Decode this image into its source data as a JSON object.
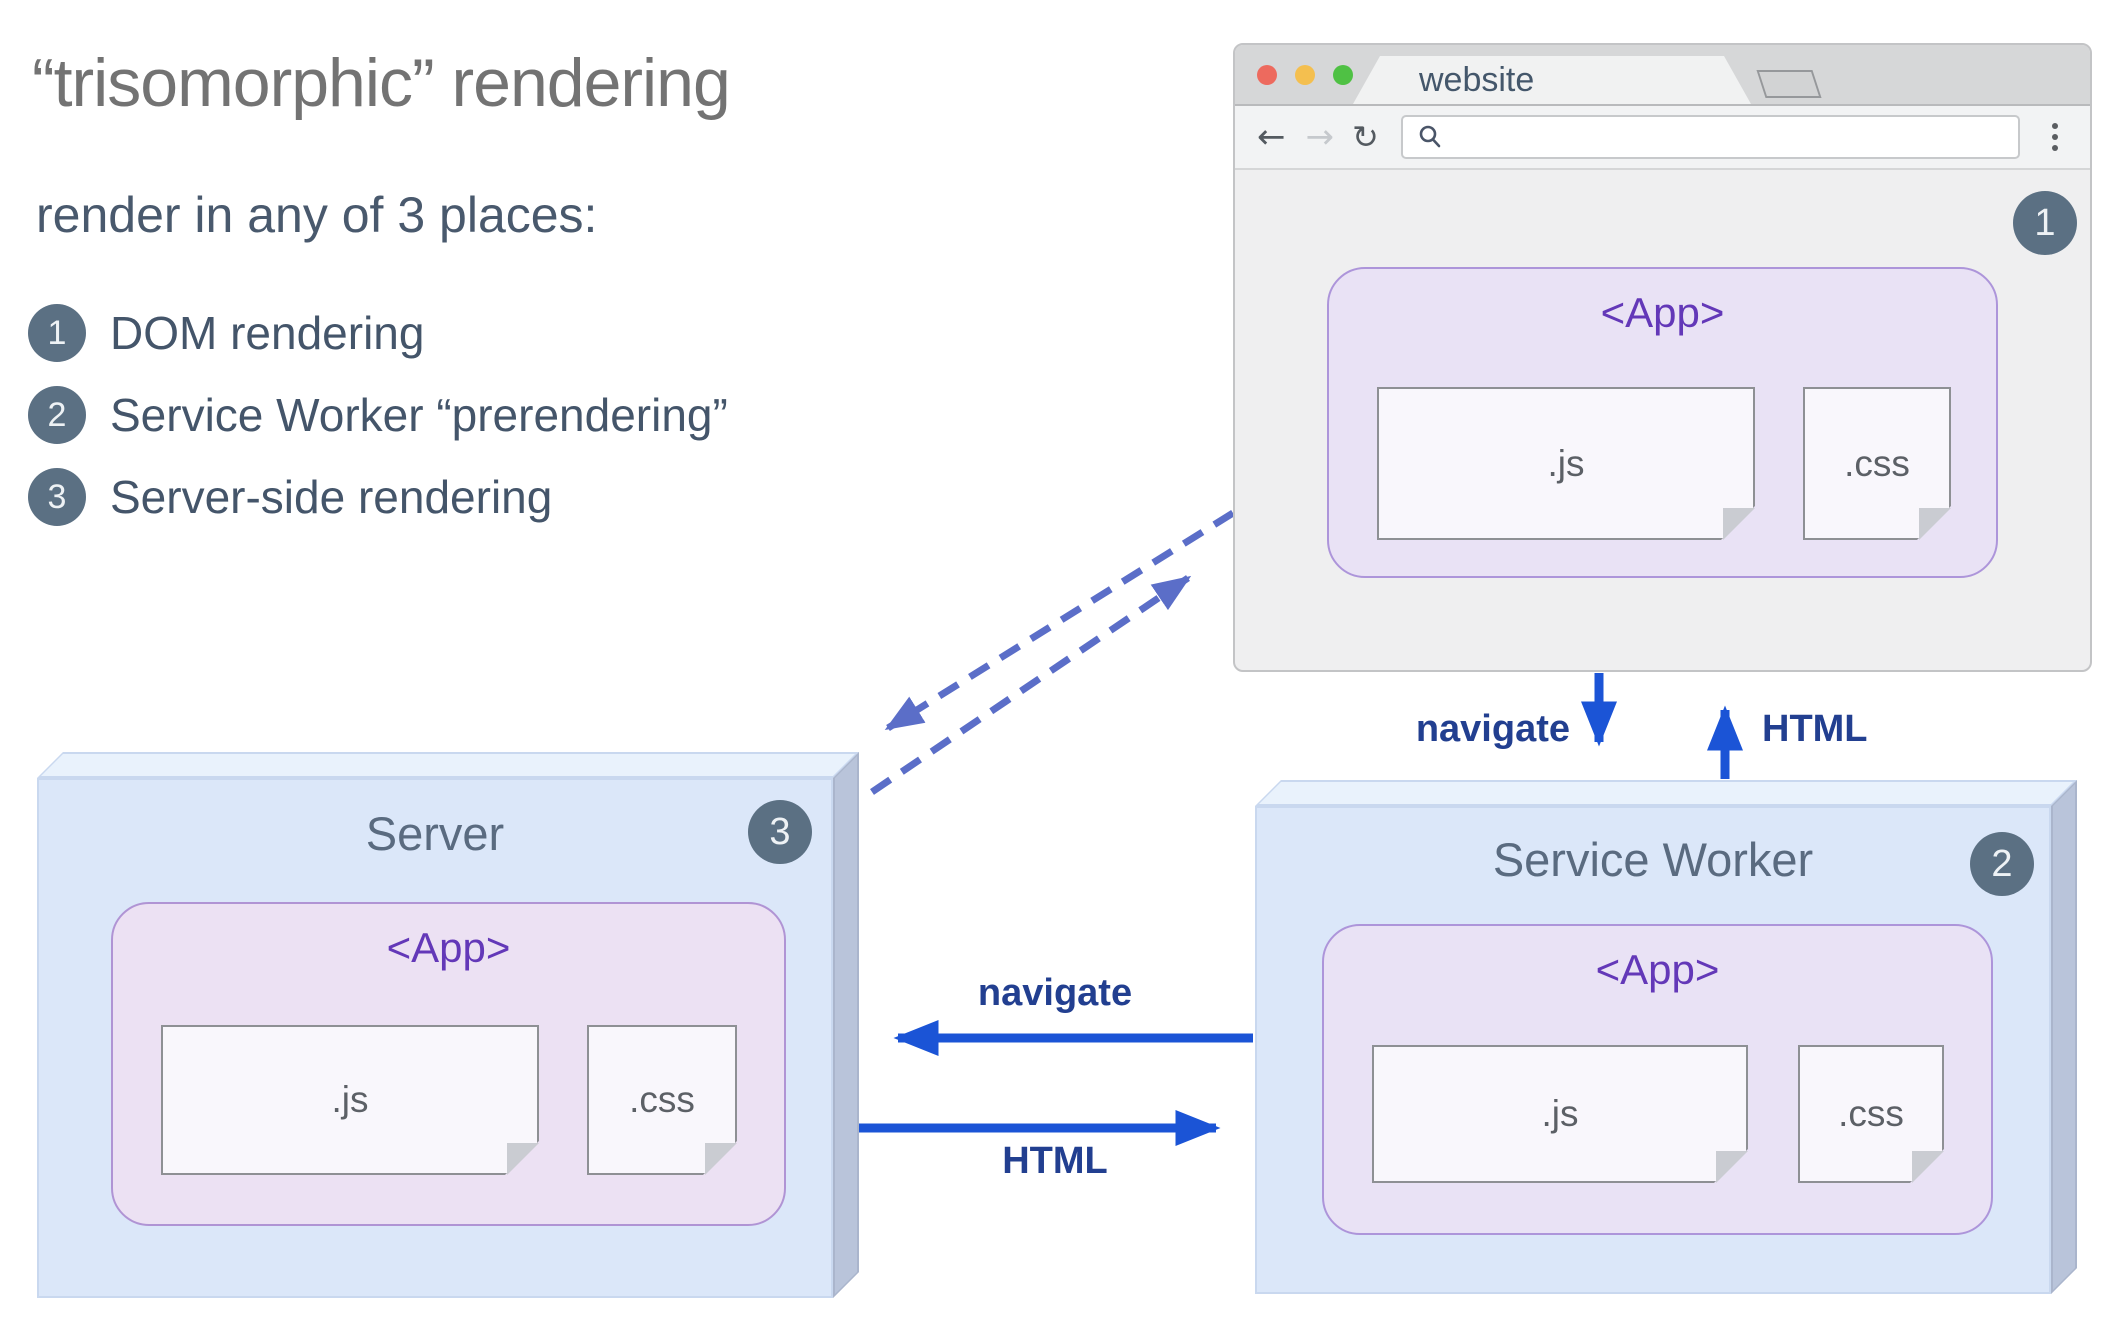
{
  "title": "“trisomorphic” rendering",
  "subtitle": "render in any of 3 places:",
  "legend": [
    {
      "num": "1",
      "label": "DOM rendering"
    },
    {
      "num": "2",
      "label": "Service Worker “prerendering”"
    },
    {
      "num": "3",
      "label": "Server-side rendering"
    }
  ],
  "browser": {
    "tab_title": "website",
    "url_value": "",
    "badge": "1",
    "icons": {
      "back": "←",
      "forward": "→",
      "reload": "↻"
    },
    "app": {
      "title": "<App>",
      "js": ".js",
      "css": ".css"
    }
  },
  "server": {
    "title": "Server",
    "badge": "3",
    "app": {
      "title": "<App>",
      "js": ".js",
      "css": ".css"
    }
  },
  "service_worker": {
    "title": "Service Worker",
    "badge": "2",
    "app": {
      "title": "<App>",
      "js": ".js",
      "css": ".css"
    }
  },
  "arrows": {
    "browser_to_sw": "navigate",
    "sw_to_browser": "HTML",
    "sw_to_server": "navigate",
    "server_to_sw": "HTML"
  },
  "colors": {
    "arrow_blue": "#1b54d6",
    "dashed_indigo": "#5b6ec8",
    "badge_slate": "#5b7083",
    "app_purple": "#6338b8",
    "box_blue": "#dbe7f9",
    "app_lavender": "#e9e2f5"
  }
}
